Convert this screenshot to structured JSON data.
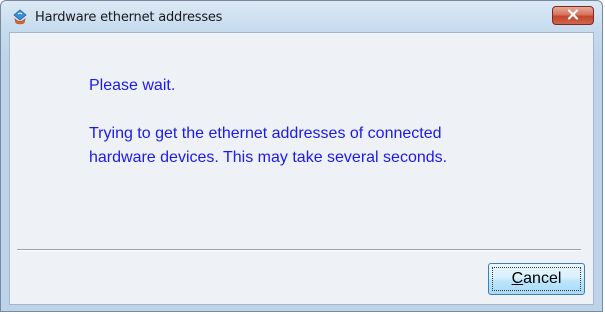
{
  "window": {
    "title": "Hardware ethernet addresses",
    "icon": "java-cup-icon",
    "close_icon": "close-x-icon"
  },
  "dialog": {
    "wait_message": "Please wait.",
    "detail_line1": "Trying to get the ethernet addresses of connected",
    "detail_line2": "hardware devices. This may take several seconds."
  },
  "buttons": {
    "cancel_mnemonic": "C",
    "cancel_rest": "ancel"
  },
  "colors": {
    "message_text": "#1a1af0",
    "close_button": "#c3452c",
    "client_background": "#eef1f6"
  }
}
